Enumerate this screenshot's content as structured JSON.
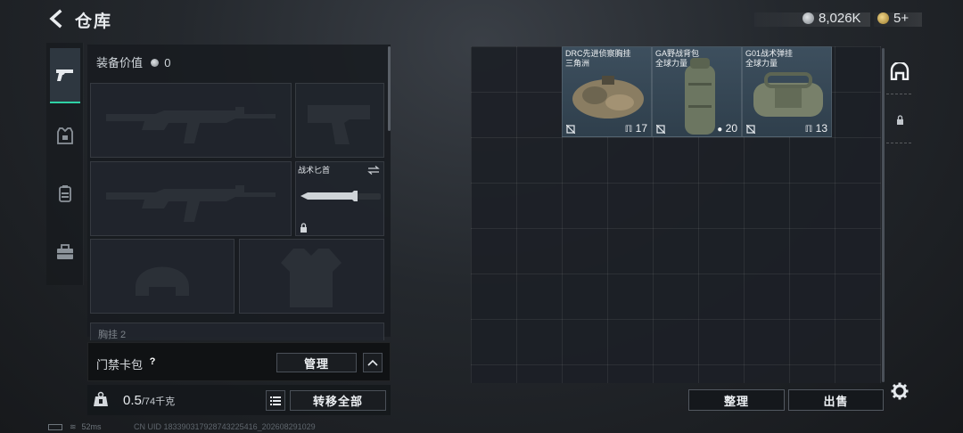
{
  "header": {
    "title": "仓库",
    "currency_main": "8,026K",
    "currency_secondary": "5+"
  },
  "nav": {
    "tabs": [
      {
        "name": "weapons",
        "active": true
      },
      {
        "name": "armor",
        "active": false
      },
      {
        "name": "backpack",
        "active": false
      },
      {
        "name": "toolbox",
        "active": false
      }
    ]
  },
  "equipment": {
    "header_label": "装备价值",
    "header_value": "0",
    "knife_label": "战术匕首",
    "next_section_label": "胸挂 2"
  },
  "card_bar": {
    "label": "门禁卡包",
    "help": "?",
    "manage_label": "管理"
  },
  "weight": {
    "current": "0.5",
    "capacity": "/74千克",
    "transfer_all_label": "转移全部"
  },
  "storage": {
    "items": [
      {
        "name_line1": "DRC先进侦察胸挂",
        "name_line2": "三角洲",
        "count": "17"
      },
      {
        "name_line1": "GA野战背包",
        "name_line2": "全球力量",
        "count": "20"
      },
      {
        "name_line1": "G01战术弹挂",
        "name_line2": "全球力量",
        "count": "13"
      }
    ],
    "sort_label": "整理",
    "sell_label": "出售"
  },
  "status_bar": {
    "ping": "52ms",
    "uid": "CN UID 183390317928743225416_202608291029"
  },
  "colors": {
    "accent": "#2fd1a5",
    "cell_bg": "#3d4f5e"
  }
}
